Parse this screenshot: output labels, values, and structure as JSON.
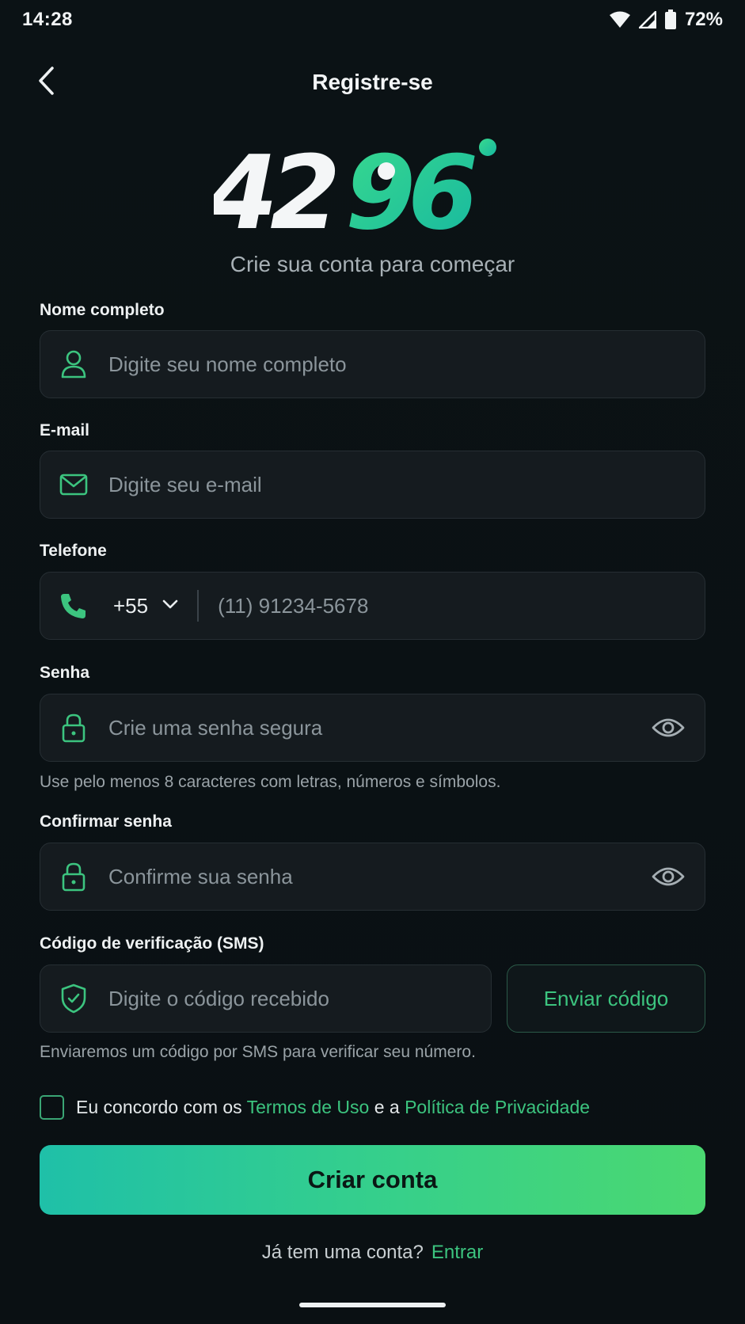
{
  "status": {
    "time": "14:28",
    "battery": "72%"
  },
  "header": {
    "title": "Registre-se"
  },
  "logo": {
    "text_white": "42",
    "text_green": "96"
  },
  "subtitle": "Crie sua conta para começar",
  "fields": {
    "name": {
      "label": "Nome completo",
      "placeholder": "Digite seu nome completo",
      "icon": "user-icon"
    },
    "email": {
      "label": "E-mail",
      "placeholder": "Digite seu e-mail",
      "icon": "mail-icon"
    },
    "phone": {
      "label": "Telefone",
      "country_code": "+55",
      "placeholder": "(11) 91234-5678",
      "icon": "phone-icon"
    },
    "password": {
      "label": "Senha",
      "placeholder": "Crie uma senha segura",
      "help": "Use pelo menos 8 caracteres com letras, números e símbolos.",
      "icon": "lock-icon"
    },
    "confirm": {
      "label": "Confirmar senha",
      "placeholder": "Confirme sua senha",
      "icon": "lock-icon"
    },
    "code": {
      "label": "Código de verificação (SMS)",
      "placeholder": "Digite o código recebido",
      "button": "Enviar código",
      "help": "Enviaremos um código por SMS para verificar seu número.",
      "icon": "shield-check-icon"
    }
  },
  "terms": {
    "prefix": "Eu concordo com os ",
    "terms_link": "Termos de Uso",
    "middle": " e a ",
    "privacy_link": "Política de Privacidade"
  },
  "primary_button": "Criar conta",
  "login": {
    "prompt": "Já tem uma conta?",
    "link": "Entrar"
  },
  "colors": {
    "accent": "#3cc47f",
    "background": "#0b1114",
    "input_bg": "#151b1f"
  }
}
